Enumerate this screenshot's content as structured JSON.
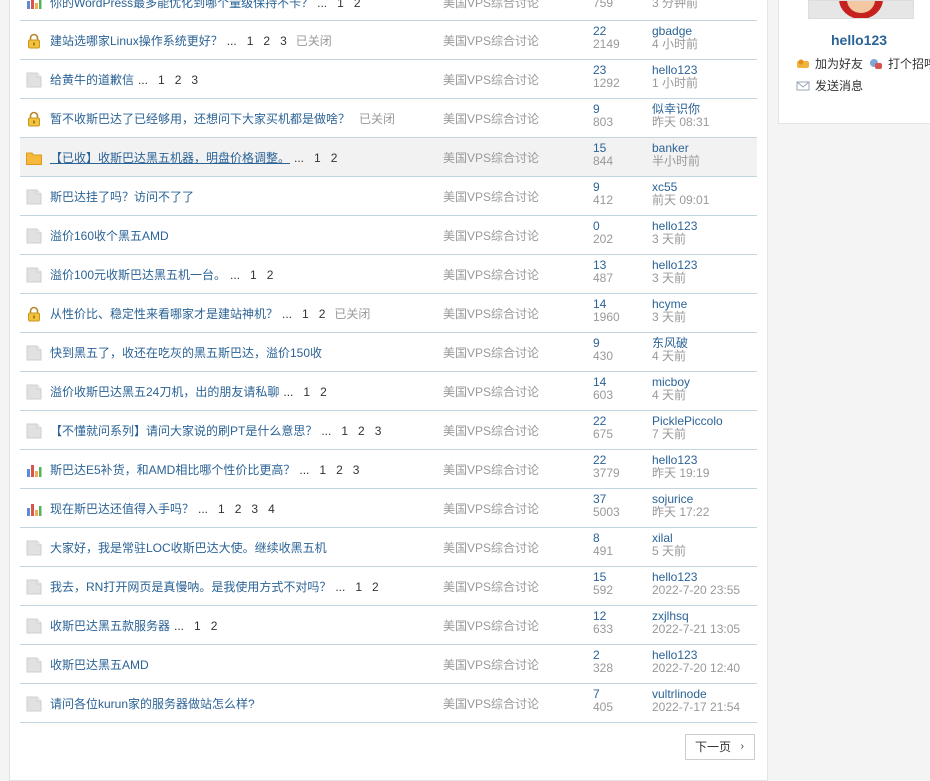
{
  "threads": [
    {
      "icon": "poll",
      "title": "你的WordPress最多能优化到哪个量级保持不卡？",
      "dots": "...",
      "pages": [
        "1",
        "2"
      ],
      "closed": "",
      "forum": "美国VPS综合讨论",
      "replies": "",
      "views": "759",
      "last_user": "",
      "last_time": "3 分钟前"
    },
    {
      "icon": "lock",
      "title": "建站选哪家Linux操作系统更好？",
      "dots": "...",
      "pages": [
        "1",
        "2",
        "3"
      ],
      "closed": "已关闭",
      "forum": "美国VPS综合讨论",
      "replies": "22",
      "views": "2149",
      "last_user": "gbadge",
      "last_time": "4 小时前"
    },
    {
      "icon": "doc",
      "title": "给黄牛的道歉信",
      "dots": "...",
      "pages": [
        "1",
        "2",
        "3"
      ],
      "closed": "",
      "forum": "美国VPS综合讨论",
      "replies": "23",
      "views": "1292",
      "last_user": "hello123",
      "last_time": "1 小时前"
    },
    {
      "icon": "lock",
      "title": "暂不收斯巴达了已经够用，还想问下大家买机都是做啥？",
      "dots": "",
      "pages": [],
      "closed": "已关闭",
      "forum": "美国VPS综合讨论",
      "replies": "9",
      "views": "803",
      "last_user": "似幸识你",
      "last_time": "昨天 08:31"
    },
    {
      "icon": "folder",
      "title": "【已收】收斯巴达黑五机器，明盘价格调整。",
      "dots": "...",
      "pages": [
        "1",
        "2"
      ],
      "closed": "",
      "forum": "美国VPS综合讨论",
      "replies": "15",
      "views": "844",
      "last_user": "banker",
      "last_time": "半小时前",
      "hl": true
    },
    {
      "icon": "doc",
      "title": "斯巴达挂了吗？访问不了了",
      "dots": "",
      "pages": [],
      "closed": "",
      "forum": "美国VPS综合讨论",
      "replies": "9",
      "views": "412",
      "last_user": "xc55",
      "last_time": "前天 09:01"
    },
    {
      "icon": "doc",
      "title": "溢价160收个黑五AMD",
      "dots": "",
      "pages": [],
      "closed": "",
      "forum": "美国VPS综合讨论",
      "replies": "0",
      "views": "202",
      "last_user": "hello123",
      "last_time": "3 天前"
    },
    {
      "icon": "doc",
      "title": "溢价100元收斯巴达黑五机一台。",
      "dots": "...",
      "pages": [
        "1",
        "2"
      ],
      "closed": "",
      "forum": "美国VPS综合讨论",
      "replies": "13",
      "views": "487",
      "last_user": "hello123",
      "last_time": "3 天前"
    },
    {
      "icon": "lock",
      "title": "从性价比、稳定性来看哪家才是建站神机？",
      "dots": "...",
      "pages": [
        "1",
        "2"
      ],
      "closed": "已关闭",
      "forum": "美国VPS综合讨论",
      "replies": "14",
      "views": "1960",
      "last_user": "hcyme",
      "last_time": "3 天前"
    },
    {
      "icon": "doc",
      "title": "快到黑五了，收还在吃灰的黑五斯巴达，溢价150收",
      "dots": "",
      "pages": [],
      "closed": "",
      "forum": "美国VPS综合讨论",
      "replies": "9",
      "views": "430",
      "last_user": "东风破",
      "last_time": "4 天前"
    },
    {
      "icon": "doc",
      "title": "溢价收斯巴达黑五24刀机，出的朋友请私聊",
      "dots": "...",
      "pages": [
        "1",
        "2"
      ],
      "closed": "",
      "forum": "美国VPS综合讨论",
      "replies": "14",
      "views": "603",
      "last_user": "micboy",
      "last_time": "4 天前"
    },
    {
      "icon": "doc",
      "title": "【不懂就问系列】请问大家说的刷PT是什么意思？",
      "dots": "...",
      "pages": [
        "1",
        "2",
        "3"
      ],
      "closed": "",
      "forum": "美国VPS综合讨论",
      "replies": "22",
      "views": "675",
      "last_user": "PicklePiccolo",
      "last_time": "7 天前"
    },
    {
      "icon": "poll",
      "title": "斯巴达E5补货，和AMD相比哪个性价比更高？",
      "dots": "...",
      "pages": [
        "1",
        "2",
        "3"
      ],
      "closed": "",
      "forum": "美国VPS综合讨论",
      "replies": "22",
      "views": "3779",
      "last_user": "hello123",
      "last_time": "昨天 19:19"
    },
    {
      "icon": "poll",
      "title": "现在斯巴达还值得入手吗？",
      "dots": "...",
      "pages": [
        "1",
        "2",
        "3",
        "4"
      ],
      "closed": "",
      "forum": "美国VPS综合讨论",
      "replies": "37",
      "views": "5003",
      "last_user": "sojurice",
      "last_time": "昨天 17:22"
    },
    {
      "icon": "doc",
      "title": "大家好，我是常驻LOC收斯巴达大使。继续收黑五机",
      "dots": "",
      "pages": [],
      "closed": "",
      "forum": "美国VPS综合讨论",
      "replies": "8",
      "views": "491",
      "last_user": "xilal",
      "last_time": "5 天前"
    },
    {
      "icon": "doc",
      "title": "我去，RN打开网页是真慢呐。是我使用方式不对吗？",
      "dots": "...",
      "pages": [
        "1",
        "2"
      ],
      "closed": "",
      "forum": "美国VPS综合讨论",
      "replies": "15",
      "views": "592",
      "last_user": "hello123",
      "last_time": "2022-7-20 23:55"
    },
    {
      "icon": "doc",
      "title": "收斯巴达黑五款服务器",
      "dots": "...",
      "pages": [
        "1",
        "2"
      ],
      "closed": "",
      "forum": "美国VPS综合讨论",
      "replies": "12",
      "views": "633",
      "last_user": "zxjlhsq",
      "last_time": "2022-7-21 13:05"
    },
    {
      "icon": "doc",
      "title": "收斯巴达黑五AMD",
      "dots": "",
      "pages": [],
      "closed": "",
      "forum": "美国VPS综合讨论",
      "replies": "2",
      "views": "328",
      "last_user": "hello123",
      "last_time": "2022-7-20 12:40"
    },
    {
      "icon": "doc",
      "title": "请问各位kurun家的服务器做站怎么样?",
      "dots": "",
      "pages": [],
      "closed": "",
      "forum": "美国VPS综合讨论",
      "replies": "7",
      "views": "405",
      "last_user": "vultrlinode",
      "last_time": "2022-7-17 21:54"
    }
  ],
  "pagination": {
    "next_label": "下一页",
    "next_arrow": "›"
  },
  "sidebar": {
    "username": "hello123",
    "add_friend": "加为好友",
    "greet": "打个招呼",
    "send_message": "发送消息"
  },
  "colors": {
    "link": "#2b6396",
    "muted": "#999999",
    "divider": "#c2d5e3"
  }
}
